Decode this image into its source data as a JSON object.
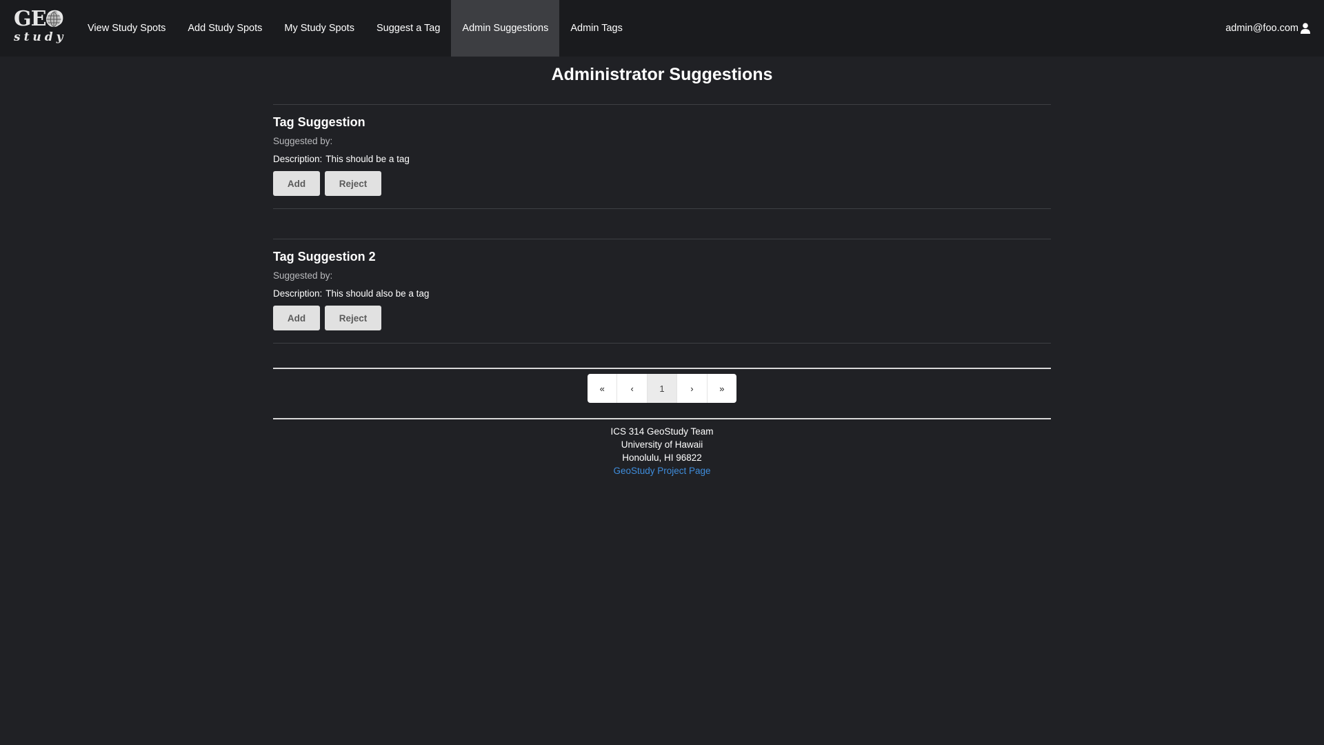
{
  "brand": {
    "logo_top": "GEO",
    "logo_bottom": "study"
  },
  "nav": {
    "items": [
      {
        "label": "View Study Spots"
      },
      {
        "label": "Add Study Spots"
      },
      {
        "label": "My Study Spots"
      },
      {
        "label": "Suggest a Tag"
      },
      {
        "label": "Admin Suggestions",
        "active": true
      },
      {
        "label": "Admin Tags"
      }
    ],
    "user": "admin@foo.com"
  },
  "page": {
    "title": "Administrator Suggestions"
  },
  "suggestions": [
    {
      "title": "Tag Suggestion",
      "suggested_by_label": "Suggested by:",
      "suggested_by": "",
      "description_label": "Description:",
      "description": "This should be a tag",
      "add_label": "Add",
      "reject_label": "Reject"
    },
    {
      "title": "Tag Suggestion 2",
      "suggested_by_label": "Suggested by:",
      "suggested_by": "",
      "description_label": "Description:",
      "description": "This should also be a tag",
      "add_label": "Add",
      "reject_label": "Reject"
    }
  ],
  "pagination": {
    "first": "«",
    "prev": "‹",
    "current": "1",
    "next": "›",
    "last": "»"
  },
  "footer": {
    "line1": "ICS 314 GeoStudy Team",
    "line2": "University of Hawaii",
    "line3": "Honolulu, HI 96822",
    "link": "GeoStudy Project Page"
  },
  "colors": {
    "background": "#202125",
    "navbar": "#1a1b1e",
    "active_nav": "#3d3e42",
    "button": "#e1e1e1",
    "link": "#3f8ddc"
  }
}
